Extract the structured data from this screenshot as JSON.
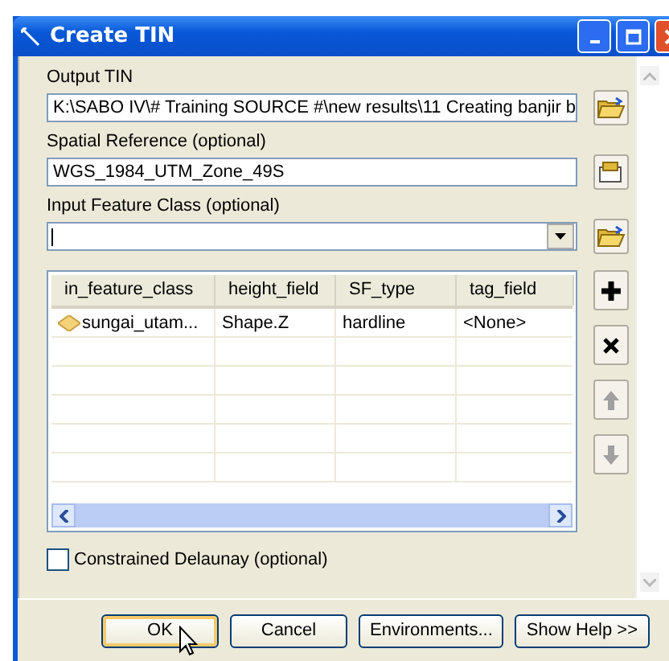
{
  "window": {
    "title": "Create TIN"
  },
  "fields": [
    {
      "kind": "text",
      "label": "Output TIN",
      "value": "K:\\SABO IV\\# Training SOURCE #\\new results\\11 Creating banjir b"
    },
    {
      "kind": "text",
      "label": "Spatial Reference (optional)",
      "value": "WGS_1984_UTM_Zone_49S"
    },
    {
      "kind": "dropdown",
      "label": "Input Feature Class (optional)"
    }
  ],
  "browse_buttons": [
    {
      "kind": "folder"
    },
    {
      "kind": "properties"
    },
    {
      "kind": "folder"
    }
  ],
  "table": {
    "columns": [
      "in_feature_class",
      "height_field",
      "SF_type",
      "tag_field"
    ],
    "rows": [
      {
        "cells": [
          "sungai_utam...",
          "Shape.Z",
          "hardline",
          "<None>"
        ]
      }
    ]
  },
  "tool_buttons": [
    {
      "kind": "add",
      "disabled": false
    },
    {
      "kind": "remove",
      "disabled": false
    },
    {
      "kind": "up",
      "disabled": true
    },
    {
      "kind": "down",
      "disabled": true
    }
  ],
  "checkbox": {
    "label": "Constrained Delaunay (optional)",
    "checked": false
  },
  "buttons": [
    {
      "label": "OK",
      "default": true
    },
    {
      "label": "Cancel",
      "default": false
    },
    {
      "label": "Environments...",
      "default": false
    },
    {
      "label": "Show Help >>",
      "default": false
    }
  ]
}
